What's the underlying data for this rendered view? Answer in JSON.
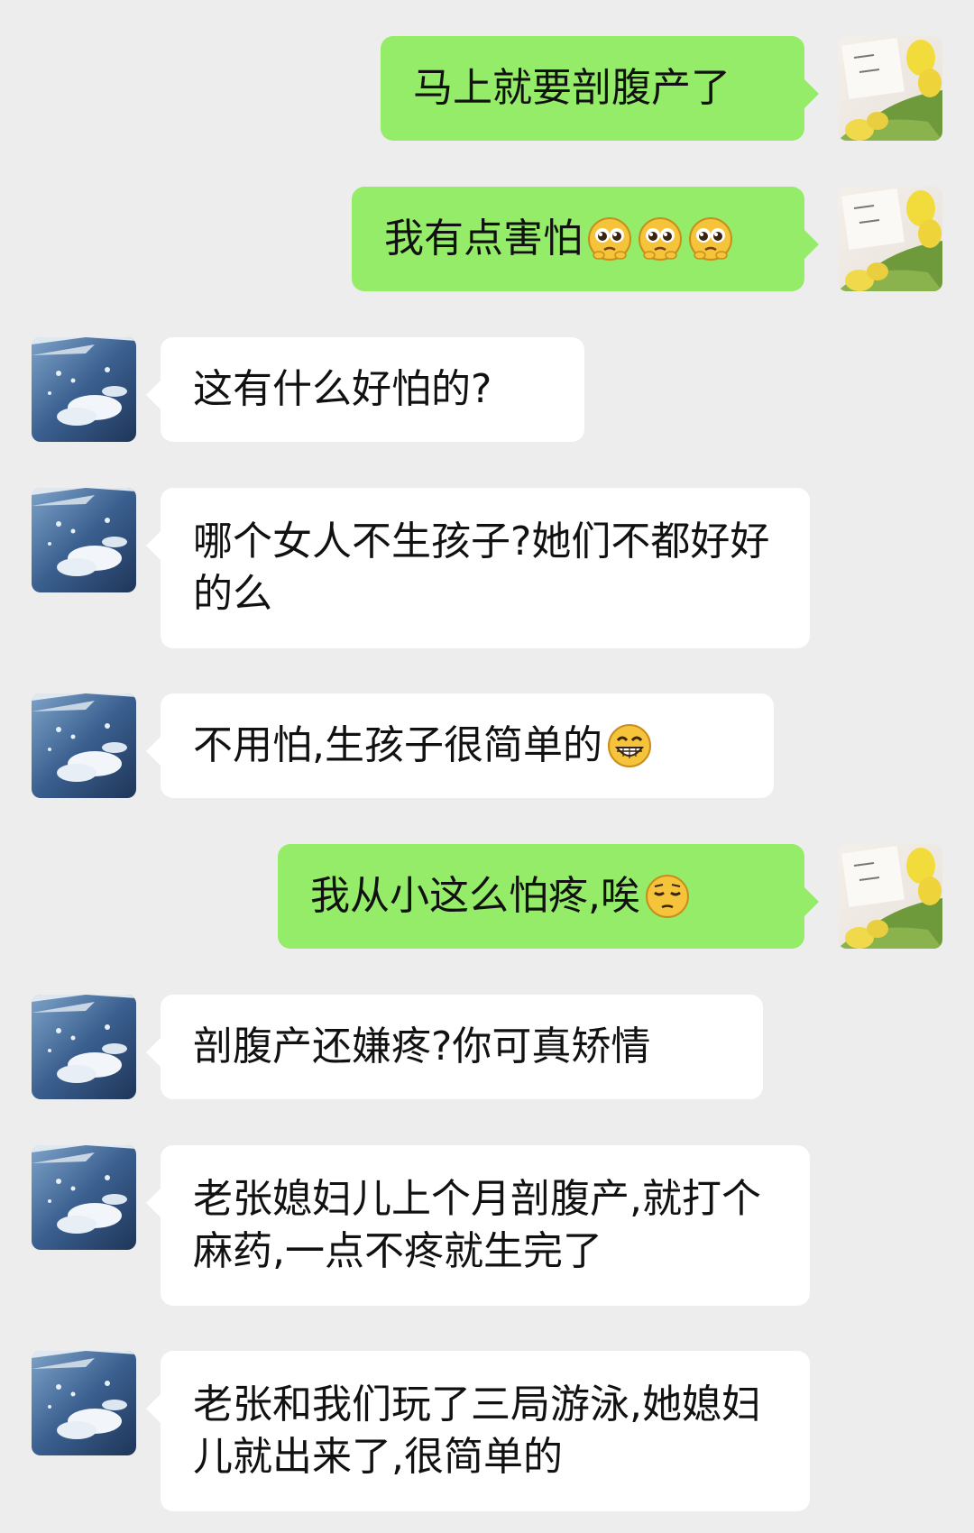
{
  "chat": {
    "messages": [
      {
        "sender": "self",
        "text": "马上就要剖腹产了"
      },
      {
        "sender": "self",
        "text": "我有点害怕",
        "emojis": [
          "pleading-face",
          "pleading-face",
          "pleading-face"
        ]
      },
      {
        "sender": "other",
        "text": "这有什么好怕的?"
      },
      {
        "sender": "other",
        "text": "哪个女人不生孩子?她们不都好好的么"
      },
      {
        "sender": "other",
        "text": "不用怕,生孩子很简单的",
        "emojis": [
          "grinning-face"
        ]
      },
      {
        "sender": "self",
        "text": "我从小这么怕疼,唉",
        "emojis": [
          "pensive-face"
        ]
      },
      {
        "sender": "other",
        "text": "剖腹产还嫌疼?你可真矫情"
      },
      {
        "sender": "other",
        "text": "老张媳妇儿上个月剖腹产,就打个麻药,一点不疼就生完了"
      },
      {
        "sender": "other",
        "text": "老张和我们玩了三局游泳,她媳妇儿就出来了,很简单的"
      }
    ]
  },
  "colors": {
    "background": "#ededed",
    "sent_bubble": "#95ec69",
    "received_bubble": "#ffffff"
  }
}
